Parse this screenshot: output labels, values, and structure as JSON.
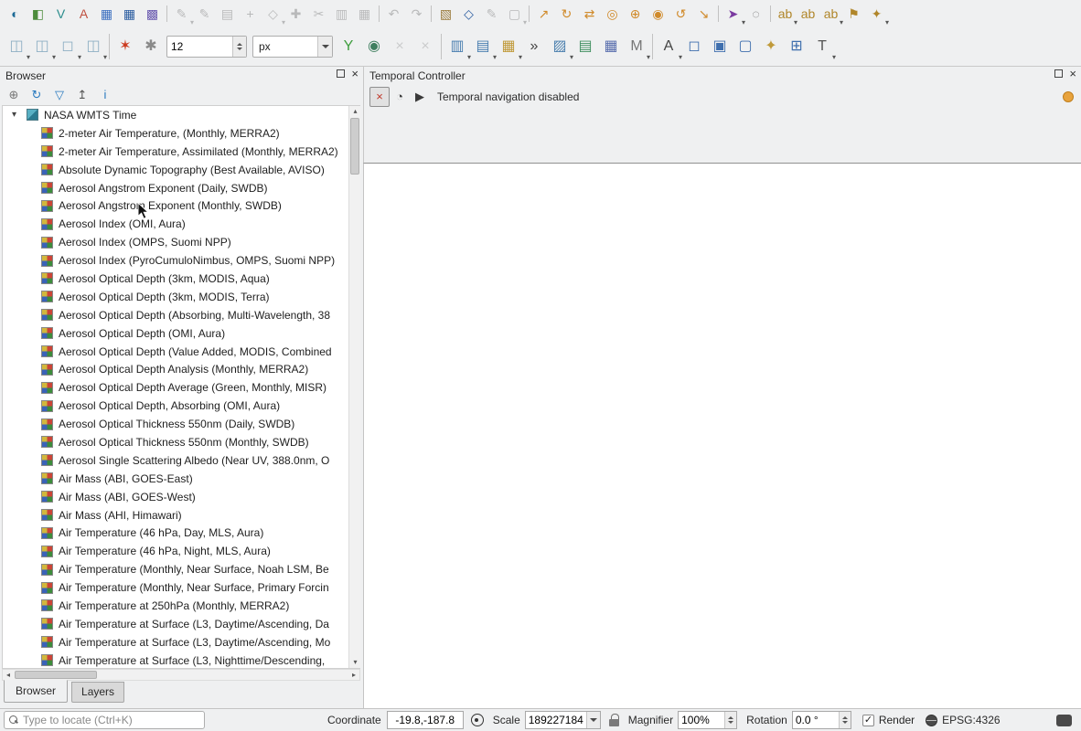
{
  "icons": {
    "close": "×",
    "expander": "▾",
    "scroll_up": "▴",
    "scroll_down": "▾",
    "scroll_left": "◂",
    "scroll_right": "▸"
  },
  "toolbar_main": {
    "items": [
      {
        "name": "metasearch-icon",
        "glyph": "◐",
        "color": "#1d6a96"
      },
      {
        "name": "style-manager-icon",
        "glyph": "◧",
        "color": "#4c8c3c"
      },
      {
        "name": "new-virtual-layer-icon",
        "glyph": "V",
        "color": "#2a8c8c"
      },
      {
        "name": "new-annotation-layer-icon",
        "glyph": "A",
        "color": "#c05040"
      },
      {
        "name": "new-mesh-layer-icon",
        "glyph": "▦",
        "color": "#3c6fc0"
      },
      {
        "name": "attribute-table-icon",
        "glyph": "▦",
        "color": "#2a5ca0"
      },
      {
        "name": "raster-checker-icon",
        "glyph": "▩",
        "color": "#6a5ab0"
      },
      {
        "name": "toolbar-separator",
        "sep": true,
        "glyph": ""
      },
      {
        "name": "current-edits-icon",
        "glyph": "✎",
        "color": "#555555",
        "disabled": true,
        "dropdown": true
      },
      {
        "name": "toggle-editing-icon",
        "glyph": "✎",
        "color": "#555555",
        "disabled": true
      },
      {
        "name": "save-edits-icon",
        "glyph": "▤",
        "color": "#555555",
        "disabled": true
      },
      {
        "name": "add-record-icon",
        "glyph": "+",
        "color": "#555555",
        "disabled": true
      },
      {
        "name": "vertex-tool-icon",
        "glyph": "◇",
        "color": "#555555",
        "disabled": true,
        "dropdown": true
      },
      {
        "name": "move-feature-icon",
        "glyph": "✚",
        "color": "#555555",
        "disabled": true
      },
      {
        "name": "cut-features-icon",
        "glyph": "✂",
        "color": "#555555",
        "disabled": true
      },
      {
        "name": "copy-features-icon",
        "glyph": "▥",
        "color": "#555555",
        "disabled": true
      },
      {
        "name": "paste-features-icon",
        "glyph": "▦",
        "color": "#555555",
        "disabled": true
      },
      {
        "name": "toolbar-separator",
        "sep": true,
        "glyph": ""
      },
      {
        "name": "undo-icon",
        "glyph": "↶",
        "color": "#555555",
        "disabled": true
      },
      {
        "name": "redo-icon",
        "glyph": "↷",
        "color": "#555555",
        "disabled": true
      },
      {
        "name": "toolbar-separator",
        "sep": true,
        "glyph": ""
      },
      {
        "name": "notebook-icon",
        "glyph": "▧",
        "color": "#9a7a3a"
      },
      {
        "name": "snapping-options-icon",
        "glyph": "◇",
        "color": "#2a5ca0"
      },
      {
        "name": "advanced-digitizing-icon",
        "glyph": "✎",
        "color": "#555555",
        "disabled": true
      },
      {
        "name": "select-region-icon",
        "glyph": "▢",
        "color": "#555555",
        "disabled": true,
        "dropdown": true
      },
      {
        "name": "toolbar-separator",
        "sep": true,
        "glyph": ""
      },
      {
        "name": "move-copy-feature-icon",
        "glyph": "↗",
        "color": "#d08a2a"
      },
      {
        "name": "rotate-feature-icon",
        "glyph": "↻",
        "color": "#d08a2a"
      },
      {
        "name": "swap-geometry-icon",
        "glyph": "⇄",
        "color": "#d08a2a"
      },
      {
        "name": "add-ring-icon",
        "glyph": "◎",
        "color": "#d08a2a"
      },
      {
        "name": "add-part-icon",
        "glyph": "⊕",
        "color": "#d08a2a"
      },
      {
        "name": "fill-ring-icon",
        "glyph": "◉",
        "color": "#d08a2a"
      },
      {
        "name": "offset-curve-icon",
        "glyph": "↺",
        "color": "#d08a2a"
      },
      {
        "name": "reshape-features-icon",
        "glyph": "↘",
        "color": "#d08a2a"
      },
      {
        "name": "toolbar-separator",
        "sep": true,
        "glyph": ""
      },
      {
        "name": "pointer-menu-icon",
        "glyph": "➤",
        "color": "#7a3aa0",
        "dropdown": true
      },
      {
        "name": "measure-icon",
        "glyph": "◌",
        "color": "#666666"
      },
      {
        "name": "toolbar-separator",
        "sep": true,
        "glyph": ""
      },
      {
        "name": "label-options-icon",
        "glyph": "ab",
        "color": "#b0862a",
        "dropdown": true
      },
      {
        "name": "label-pin-icon",
        "glyph": "ab",
        "color": "#b0862a"
      },
      {
        "name": "label-show-hide-icon",
        "glyph": "ab",
        "color": "#b0862a",
        "dropdown": true
      },
      {
        "name": "label-flag-icon",
        "glyph": "⚑",
        "color": "#b0862a"
      },
      {
        "name": "label-highlight-icon",
        "glyph": "✦",
        "color": "#b0862a",
        "dropdown": true
      }
    ]
  },
  "toolbar_secondary": {
    "items_left": [
      {
        "name": "pan-menu-icon",
        "glyph": "◫",
        "color": "#8fb0c4",
        "dropdown": true
      },
      {
        "name": "zoom-menu-icon",
        "glyph": "◫",
        "color": "#8fb0c4",
        "dropdown": true
      },
      {
        "name": "extent-menu-icon",
        "glyph": "◻",
        "color": "#8fb0c4",
        "dropdown": true
      },
      {
        "name": "layer-menu-icon",
        "glyph": "◫",
        "color": "#8fb0c4",
        "dropdown": true
      },
      {
        "name": "toolbar-separator",
        "sep": true,
        "glyph": ""
      },
      {
        "name": "discard-edits-icon",
        "glyph": "✶",
        "color": "#cc3a1f"
      },
      {
        "name": "auto-style-icon",
        "glyph": "✱",
        "color": "#8a8a8a"
      }
    ],
    "font_size_value": "12",
    "unit_value": "px",
    "items_right": [
      {
        "name": "vector-split-icon",
        "glyph": "Y",
        "color": "#3f9e3f"
      },
      {
        "name": "globe-tool-icon",
        "glyph": "◉",
        "color": "#3f7f5f"
      },
      {
        "name": "clear-style-icon",
        "glyph": "×",
        "color": "#888888",
        "disabled": true
      },
      {
        "name": "clear-all-icon",
        "glyph": "×",
        "color": "#888888",
        "disabled": true
      },
      {
        "name": "toolbar-separator",
        "sep": true,
        "glyph": ""
      },
      {
        "name": "bookmark-menu-icon",
        "glyph": "▥",
        "color": "#4a7fb0",
        "dropdown": true
      },
      {
        "name": "map-theme-menu-icon",
        "glyph": "▤",
        "color": "#4a7fb0",
        "dropdown": true
      },
      {
        "name": "palette-menu-icon",
        "glyph": "▦",
        "color": "#c09a3a",
        "dropdown": true
      },
      {
        "name": "toolbar-overflow-icon",
        "glyph": "»",
        "color": "#444444"
      },
      {
        "name": "hatch-style-icon",
        "glyph": "▨",
        "color": "#4a7fae",
        "dropdown": true
      },
      {
        "name": "edit-map-icon",
        "glyph": "▤",
        "color": "#3f8f5f"
      },
      {
        "name": "diagram-options-icon",
        "glyph": "▦",
        "color": "#5a6fae"
      },
      {
        "name": "mesh-menu-icon",
        "glyph": "M",
        "color": "#777777",
        "dropdown": true
      },
      {
        "name": "toolbar-separator",
        "sep": true,
        "glyph": ""
      },
      {
        "name": "text-annotation-icon",
        "glyph": "A",
        "color": "#444444",
        "dropdown": true
      },
      {
        "name": "select-rectangle-icon",
        "glyph": "◻",
        "color": "#3f6fae"
      },
      {
        "name": "select-polygon-icon",
        "glyph": "▣",
        "color": "#3f6fae"
      },
      {
        "name": "select-freehand-icon",
        "glyph": "▢",
        "color": "#3f6fae"
      },
      {
        "name": "favorites-icon",
        "glyph": "✦",
        "color": "#c09a3a"
      },
      {
        "name": "select-radius-icon",
        "glyph": "⊞",
        "color": "#3f6fae"
      },
      {
        "name": "text-tool-icon",
        "glyph": "T",
        "color": "#555555",
        "dropdown": true
      }
    ]
  },
  "browser_panel": {
    "title": "Browser",
    "toolbar": [
      {
        "name": "add-selected-layers-icon",
        "glyph": "⊕",
        "color": "#777777"
      },
      {
        "name": "refresh-icon",
        "glyph": "↻",
        "color": "#2a7abf"
      },
      {
        "name": "filter-browser-icon",
        "glyph": "▽",
        "color": "#2a7abf"
      },
      {
        "name": "collapse-all-icon",
        "glyph": "↥",
        "color": "#555555"
      },
      {
        "name": "properties-widget-icon",
        "glyph": "i",
        "color": "#2a7abf"
      }
    ],
    "root_label": "NASA WMTS Time",
    "items": [
      "2-meter Air Temperature, (Monthly, MERRA2)",
      "2-meter Air Temperature, Assimilated (Monthly, MERRA2)",
      "Absolute Dynamic Topography (Best Available, AVISO)",
      "Aerosol Angstrom Exponent (Daily, SWDB)",
      "Aerosol Angstrom Exponent (Monthly, SWDB)",
      "Aerosol Index (OMI, Aura)",
      "Aerosol Index (OMPS, Suomi NPP)",
      "Aerosol Index (PyroCumuloNimbus, OMPS, Suomi NPP)",
      "Aerosol Optical Depth (3km, MODIS, Aqua)",
      "Aerosol Optical Depth (3km, MODIS, Terra)",
      "Aerosol Optical Depth (Absorbing, Multi-Wavelength, 38",
      "Aerosol Optical Depth (OMI, Aura)",
      "Aerosol Optical Depth (Value Added, MODIS, Combined",
      "Aerosol Optical Depth Analysis (Monthly, MERRA2)",
      "Aerosol Optical Depth Average (Green, Monthly, MISR)",
      "Aerosol Optical Depth, Absorbing (OMI, Aura)",
      "Aerosol Optical Thickness 550nm (Daily, SWDB)",
      "Aerosol Optical Thickness 550nm (Monthly, SWDB)",
      "Aerosol Single Scattering Albedo (Near UV, 388.0nm, O",
      "Air Mass (ABI, GOES-East)",
      "Air Mass (ABI, GOES-West)",
      "Air Mass (AHI, Himawari)",
      "Air Temperature (46 hPa, Day, MLS, Aura)",
      "Air Temperature (46 hPa, Night, MLS, Aura)",
      "Air Temperature (Monthly, Near Surface, Noah LSM, Be",
      "Air Temperature (Monthly, Near Surface, Primary Forcin",
      "Air Temperature at 250hPa (Monthly, MERRA2)",
      "Air Temperature at Surface (L3, Daytime/Ascending, Da",
      "Air Temperature at Surface (L3, Daytime/Ascending, Mo",
      "Air Temperature at Surface (L3, Nighttime/Descending,"
    ],
    "tabs": [
      {
        "name": "tab-browser",
        "label": "Browser",
        "active": true
      },
      {
        "name": "tab-layers",
        "label": "Layers",
        "active": false
      }
    ]
  },
  "temporal_panel": {
    "title": "Temporal Controller",
    "status_text": "Temporal navigation disabled",
    "buttons": [
      {
        "name": "temporal-off-button",
        "glyph": "×",
        "color": "#c0392b",
        "active": true
      },
      {
        "name": "temporal-fixed-range-button",
        "glyph": "◔",
        "color": "#3a3a3a"
      },
      {
        "name": "temporal-animated-button",
        "glyph": "▶",
        "color": "#3a3a3a"
      }
    ]
  },
  "status_bar": {
    "locator_placeholder": "Type to locate (Ctrl+K)",
    "coordinate_label": "Coordinate",
    "coordinate_value": "-19.8,-187.8",
    "scale_label": "Scale",
    "scale_value": "189227184",
    "magnifier_label": "Magnifier",
    "magnifier_value": "100%",
    "rotation_label": "Rotation",
    "rotation_value": "0.0 °",
    "render_label": "Render",
    "render_checked": true,
    "crs": "EPSG:4326"
  }
}
